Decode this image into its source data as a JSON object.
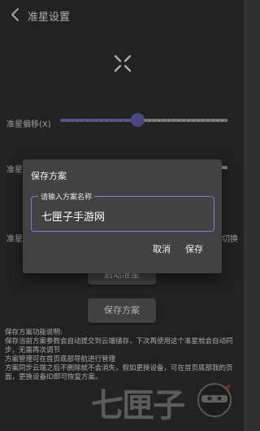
{
  "header": {
    "title": "准星设置"
  },
  "rows": {
    "offset_label": "准星偏移(X)",
    "offset_value": 0.46,
    "second_label_fragment": "准星",
    "third_label_fragment": "准星",
    "switch_fragment": "切换"
  },
  "buttons": {
    "start": "启动准星",
    "save_scheme": "保存方案"
  },
  "info": {
    "lines": [
      "保存方案功能说明:",
      "保存当前方案参数会自动提交到云端储存，下次再使用这个准星就会自动同步，无需再次调节",
      "方案管理可在首页底部导航进行管理",
      "方案同步云端之后不删除就不会消失，假如更换设备，可在首页底部我的页面，更换设备ID即可恢复方案。"
    ]
  },
  "watermark": {
    "text": "七匣子"
  },
  "dialog": {
    "title": "保存方案",
    "field_label": "请输入方案名称",
    "field_value": "七匣子手游网",
    "cancel": "取消",
    "save": "保存"
  },
  "colors": {
    "background": "#303030",
    "accent": "#7f7bd6",
    "dialog": "#424242"
  }
}
